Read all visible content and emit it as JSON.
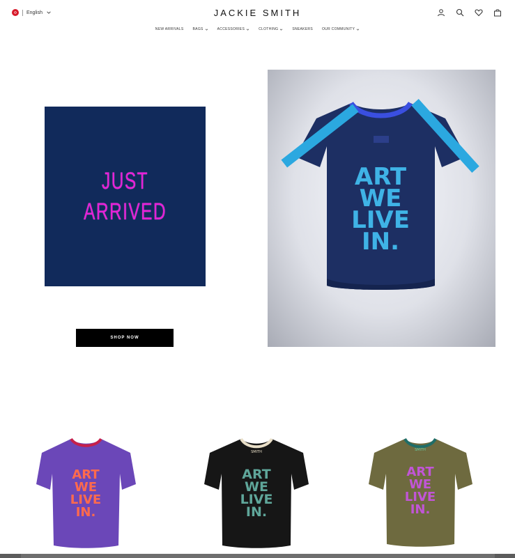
{
  "header": {
    "language": "English",
    "logo": "JACKIE SMITH",
    "icons": [
      "account-icon",
      "search-icon",
      "heart-icon",
      "bag-icon"
    ]
  },
  "nav": {
    "items": [
      {
        "label": "NEW ARRIVALS",
        "has_dropdown": false
      },
      {
        "label": "BAGS",
        "has_dropdown": true
      },
      {
        "label": "ACCESSORIES",
        "has_dropdown": true
      },
      {
        "label": "CLOTHING",
        "has_dropdown": true
      },
      {
        "label": "SNEAKERS",
        "has_dropdown": false
      },
      {
        "label": "OUR COMMUNITY",
        "has_dropdown": true
      }
    ]
  },
  "promo": {
    "line1": "JUST",
    "line2": "ARRIVED",
    "button": "SHOP NOW",
    "background": "#112a5b",
    "text_color": "#e61fd8"
  },
  "hero": {
    "shirt_text": [
      "ART",
      "WE",
      "LIVE",
      "IN."
    ],
    "shirt_color": "#1d2f63",
    "print_color": "#3fb3e6",
    "tape_color": "#2ba8e0"
  },
  "products": [
    {
      "shirt_text": [
        "ART",
        "WE",
        "LIVE",
        "IN."
      ],
      "shirt_color": "#6b47b8",
      "print_color": "#ff6a4d",
      "collar_color": "#c6204a"
    },
    {
      "shirt_text": [
        "ART",
        "WE",
        "LIVE",
        "IN."
      ],
      "shirt_color": "#161616",
      "print_color": "#5fa69a",
      "collar_color": "#e9dfc8",
      "collar_label": "SMITH"
    },
    {
      "shirt_text": [
        "ART",
        "WE",
        "LIVE",
        "IN."
      ],
      "shirt_color": "#6e6a3f",
      "print_color": "#c155d6",
      "collar_color": "#1f6d68",
      "collar_label": "SMITH"
    }
  ]
}
